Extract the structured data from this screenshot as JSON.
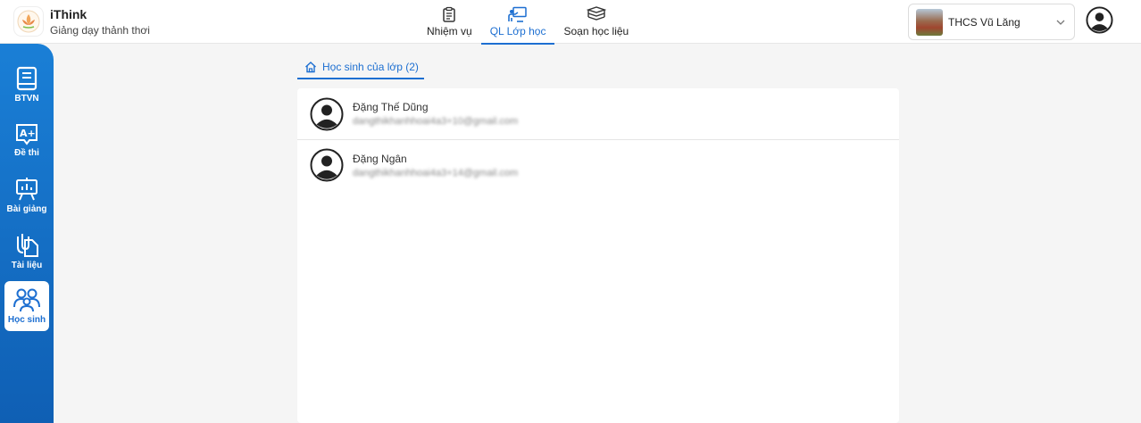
{
  "brand": {
    "title": "iThink",
    "subtitle": "Giảng dạy thảnh thơi"
  },
  "nav": {
    "tabs": [
      {
        "label": "Nhiệm vụ",
        "icon": "clipboard-icon",
        "active": false
      },
      {
        "label": "QL Lớp học",
        "icon": "classroom-icon",
        "active": true
      },
      {
        "label": "Soạn học liệu",
        "icon": "books-icon",
        "active": false
      }
    ]
  },
  "school": {
    "name": "THCS Vũ Lăng"
  },
  "sidebar": {
    "items": [
      {
        "label": "BTVN",
        "icon": "book-icon",
        "active": false
      },
      {
        "label": "Đề thi",
        "icon": "grade-icon",
        "active": false
      },
      {
        "label": "Bài giảng",
        "icon": "presentation-icon",
        "active": false
      },
      {
        "label": "Tài liệu",
        "icon": "attachment-icon",
        "active": false
      },
      {
        "label": "Học sinh",
        "icon": "students-icon",
        "active": true
      }
    ]
  },
  "content": {
    "tab_label": "Học sinh của lớp (2)",
    "students": [
      {
        "name": "Đặng Thế Dũng",
        "email": "dangthikhanhhoai4a3+10@gmail.com"
      },
      {
        "name": "Đặng Ngân",
        "email": "dangthikhanhhoai4a3+14@gmail.com"
      }
    ]
  },
  "colors": {
    "accent": "#1d6fd1",
    "sidebar": "#1573c9",
    "background": "#f5f5f5"
  }
}
